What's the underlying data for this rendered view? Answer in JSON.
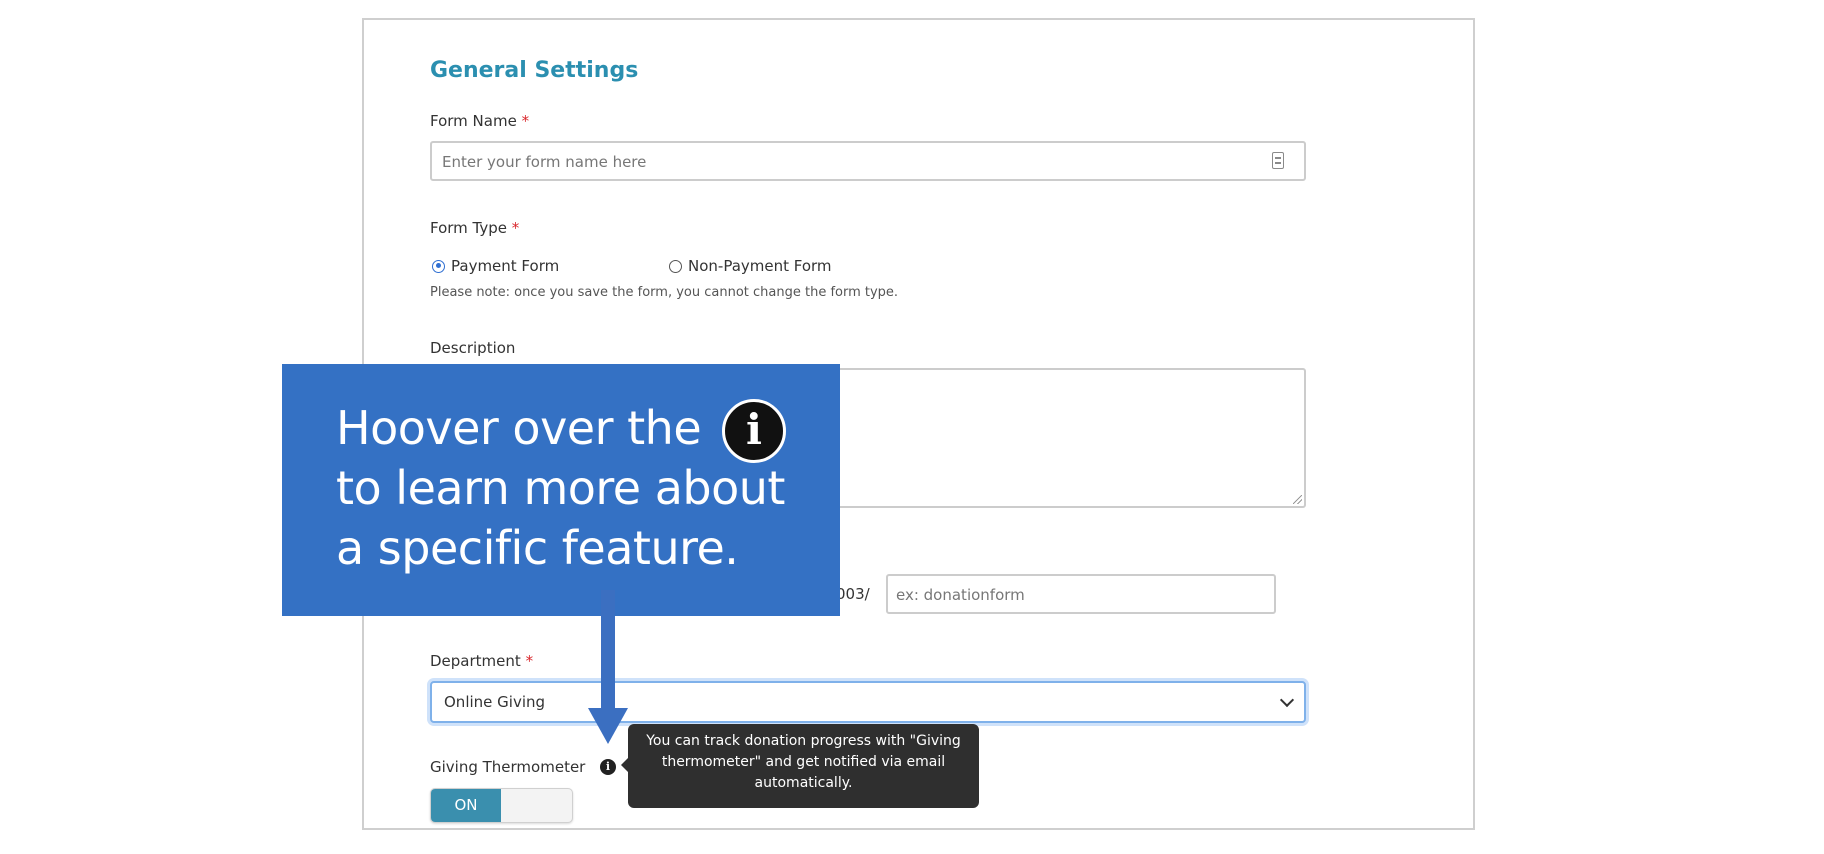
{
  "section": {
    "title": "General Settings"
  },
  "form_name": {
    "label": "Form Name",
    "required_mark": "*",
    "placeholder": "Enter your form name here"
  },
  "form_type": {
    "label": "Form Type",
    "required_mark": "*",
    "options": [
      {
        "label": "Payment Form",
        "selected": true
      },
      {
        "label": "Non-Payment Form",
        "selected": false
      }
    ],
    "note": "Please note: once you save the form, you cannot change the form type."
  },
  "description": {
    "label": "Description"
  },
  "url": {
    "prefix_tail": "003/",
    "placeholder": "ex: donationform"
  },
  "department": {
    "label": "Department",
    "required_mark": "*",
    "value": "Online Giving"
  },
  "giving_thermometer": {
    "label": "Giving Thermometer",
    "toggle_label": "ON"
  },
  "tooltip": {
    "text": "You can track donation progress with \"Giving thermometer\" and get notified via email automatically."
  },
  "callout": {
    "lines": [
      "Hoover over the",
      "to learn more about",
      "a specific feature."
    ],
    "icon_glyph": "i"
  },
  "info_icon": {
    "glyph": "i"
  },
  "colors": {
    "accent": "#2b8fb0",
    "callout_bg": "#3471c4",
    "toggle_on": "#3a8fae",
    "required": "#d9262b"
  }
}
